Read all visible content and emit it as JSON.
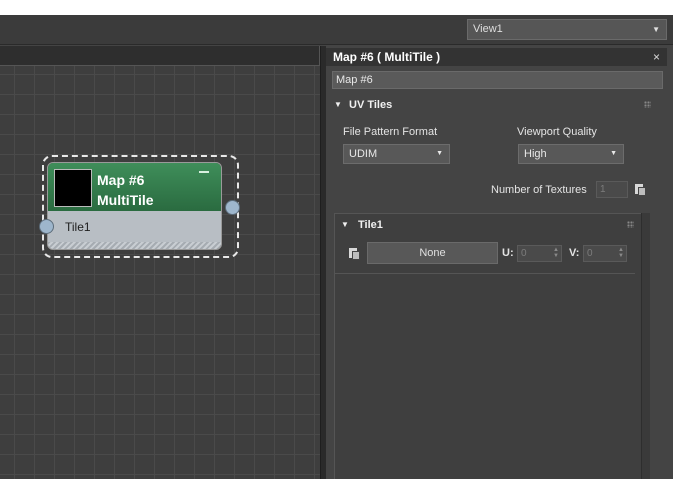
{
  "viewport": {
    "selected": "View1"
  },
  "node": {
    "title_line1": "Map #6",
    "title_line2": "MultiTile",
    "port_label": "Tile1",
    "header_color": "#2e7a4a"
  },
  "panel": {
    "title": "Map #6  ( MultiTile )",
    "name_value": "Map #6",
    "rollout_uv": "UV Tiles",
    "file_pattern_label": "File Pattern Format",
    "file_pattern_value": "UDIM",
    "viewport_quality_label": "Viewport Quality",
    "viewport_quality_value": "High",
    "num_textures_label": "Number of Textures",
    "num_textures_value": "1",
    "tile_label": "Tile1",
    "tile_map_label": "None",
    "u_label": "U:",
    "u_value": "0",
    "v_label": "V:",
    "v_value": "0",
    "close_glyph": "×"
  },
  "icons": {
    "dropdown": "triangle-down",
    "collapse": "triangle-down",
    "copy": "document-icon"
  }
}
